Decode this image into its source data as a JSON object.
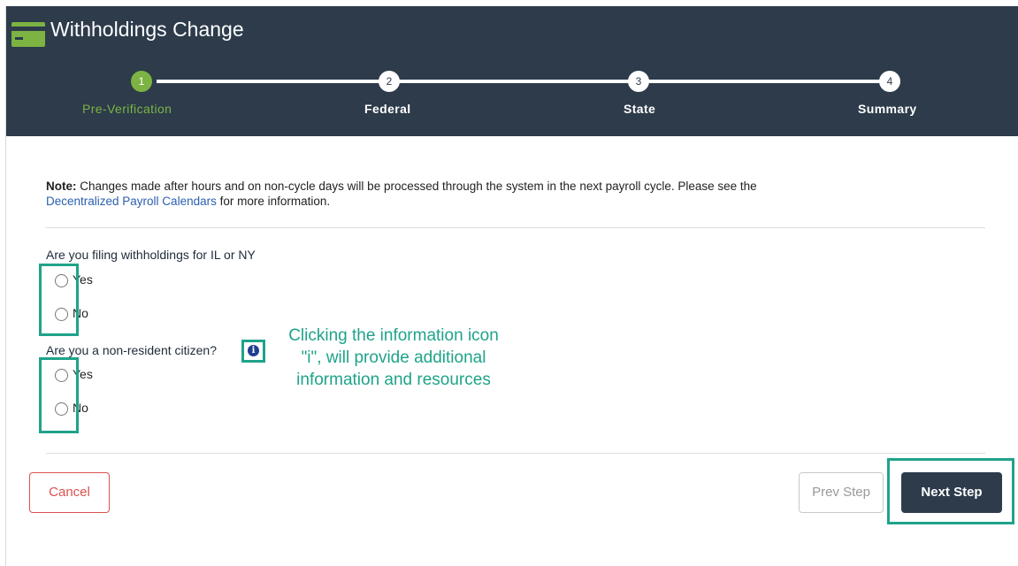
{
  "header": {
    "title": "Withholdings Change"
  },
  "steps": [
    {
      "number": "1",
      "label": "Pre-Verification",
      "active": true
    },
    {
      "number": "2",
      "label": "Federal",
      "active": false
    },
    {
      "number": "3",
      "label": "State",
      "active": false
    },
    {
      "number": "4",
      "label": "Summary",
      "active": false
    }
  ],
  "note": {
    "label": "Note:",
    "text": " Changes made after hours and on non-cycle days will be processed through the system in the next payroll cycle. Please see the",
    "link": "Decentralized Payroll Calendars",
    "suffix": " for more information."
  },
  "questions": [
    {
      "text": "Are you filing withholdings for IL or NY",
      "options": [
        "Yes",
        "No"
      ]
    },
    {
      "text": "Are you a non-resident citizen?",
      "options": [
        "Yes",
        "No"
      ]
    }
  ],
  "callout": {
    "lines": [
      "Clicking the information icon",
      "\"i\", will provide additional",
      "information and resources"
    ]
  },
  "buttons": {
    "cancel": "Cancel",
    "prev": "Prev Step",
    "next": "Next Step"
  },
  "colors": {
    "header_bg": "#2d3b4b",
    "active_step": "#7cb342",
    "highlight": "#1fa38a",
    "cancel": "#d9534f",
    "link": "#2a5fb0"
  }
}
